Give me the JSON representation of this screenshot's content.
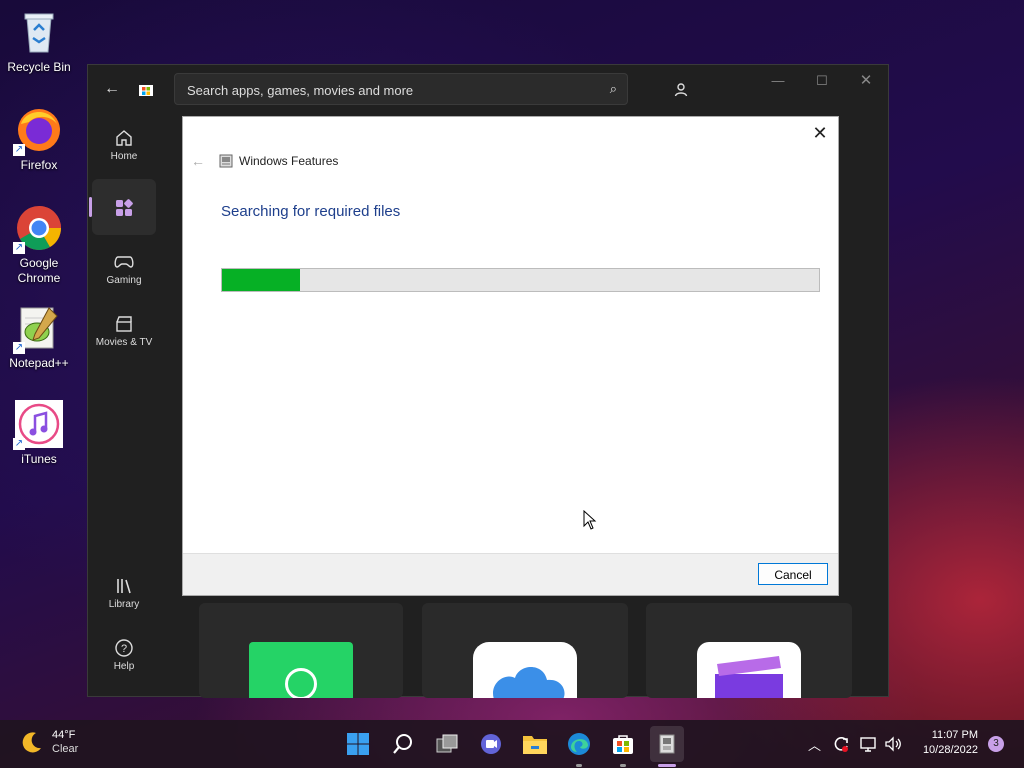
{
  "desktop": {
    "icons": [
      {
        "label": "Recycle Bin"
      },
      {
        "label": "Firefox"
      },
      {
        "label": "Google Chrome"
      },
      {
        "label": "Notepad++"
      },
      {
        "label": "iTunes"
      }
    ]
  },
  "store": {
    "search_placeholder": "Search apps, games, movies and more",
    "nav": [
      {
        "label": "Home"
      },
      {
        "label": ""
      },
      {
        "label": "Gaming"
      },
      {
        "label": "Movies & TV"
      },
      {
        "label": "Library"
      },
      {
        "label": "Help"
      }
    ]
  },
  "dialog": {
    "title": "Windows Features",
    "heading": "Searching for required files",
    "progress_fraction": 0.13,
    "cancel_label": "Cancel",
    "close_glyph": "✕",
    "colors": {
      "progress": "#06b025",
      "heading": "#1e3f8c"
    }
  },
  "taskbar": {
    "weather_temp": "44°F",
    "weather_desc": "Clear",
    "time": "11:07 PM",
    "date": "10/28/2022",
    "notification_count": "3"
  }
}
